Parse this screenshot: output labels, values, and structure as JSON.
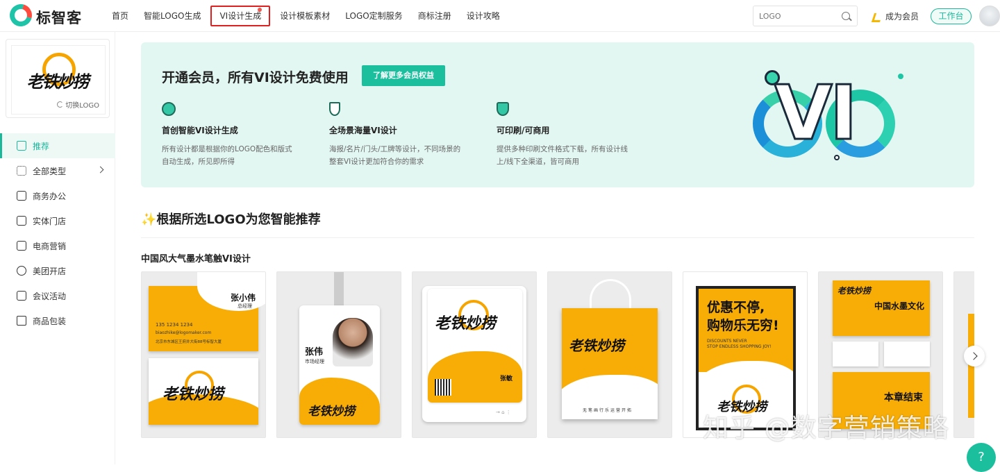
{
  "brand": {
    "name": "标智客"
  },
  "nav": {
    "items": [
      {
        "label": "首页"
      },
      {
        "label": "智能LOGO生成"
      },
      {
        "label": "VI设计生成"
      },
      {
        "label": "设计模板素材"
      },
      {
        "label": "LOGO定制服务"
      },
      {
        "label": "商标注册"
      },
      {
        "label": "设计攻略"
      }
    ]
  },
  "search": {
    "placeholder": "LOGO"
  },
  "header": {
    "member": "成为会员",
    "workbench": "工作台"
  },
  "sidebar": {
    "swap_logo": "切换LOGO",
    "items": [
      {
        "label": "推荐"
      },
      {
        "label": "全部类型"
      },
      {
        "label": "商务办公"
      },
      {
        "label": "实体门店"
      },
      {
        "label": "电商营销"
      },
      {
        "label": "美团开店"
      },
      {
        "label": "会议活动"
      },
      {
        "label": "商品包装"
      }
    ]
  },
  "banner": {
    "title": "开通会员，所有VI设计免费使用",
    "button": "了解更多会员权益",
    "features": [
      {
        "title": "首创智能VI设计生成",
        "desc1": "所有设计都是根据你的LOGO配色和版式",
        "desc2": "自动生成，所见即所得"
      },
      {
        "title": "全场景海量VI设计",
        "desc1": "海报/名片/门头/工牌等设计，不同场景的",
        "desc2": "整套VI设计更加符合你的需求"
      },
      {
        "title": "可印刷/可商用",
        "desc1": "提供多种印刷文件格式下载，所有设计线",
        "desc2": "上/线下全渠道，皆可商用"
      }
    ],
    "art": "VI"
  },
  "section": {
    "title": "✨根据所选LOGO为您智能推荐",
    "group_title": "中国风大气墨水笔触VI设计"
  },
  "cards": {
    "logo_text": "老铁炒捞",
    "business_card": {
      "name": "张小伟",
      "role": "总经理",
      "phone": "135 1234 1234",
      "email": "biaozhike@logomaker.com",
      "address": "北京市东城区王府井大街88号标智大厦"
    },
    "badge": {
      "name": "张伟",
      "role": "市场经理"
    },
    "tablet_card": {
      "name": "张敏"
    },
    "bag_text": "无笔画行乐运营开拓",
    "poster": {
      "line1": "优惠不停,",
      "line2": "购物乐无穷!",
      "en1": "DISCOUNTS NEVER",
      "en2": "STOP ENDLESS SHOPPING JOY!"
    },
    "stationery": {
      "top": "中国水墨文化",
      "bottom": "本章结束"
    }
  },
  "watermark": "知乎 @数字营销策略",
  "help": "?"
}
